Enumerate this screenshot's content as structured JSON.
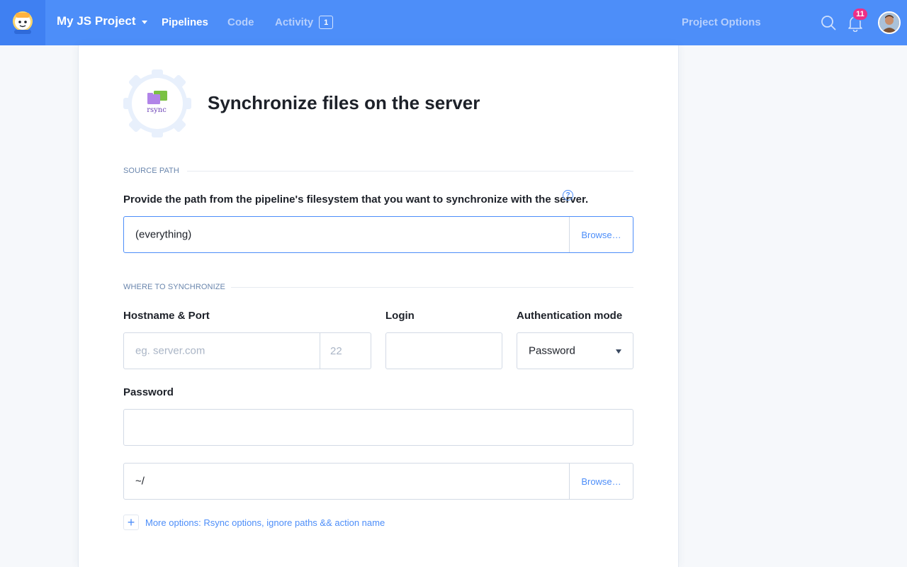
{
  "header": {
    "project_name": "My JS Project",
    "nav": {
      "pipelines": "Pipelines",
      "code": "Code",
      "activity": "Activity",
      "activity_count": "1"
    },
    "project_options": "Project Options",
    "notifications_count": "11"
  },
  "action": {
    "icon_label": "rsync",
    "title": "Synchronize files on the server"
  },
  "source_section": {
    "label": "SOURCE PATH",
    "field_label": "Provide the path from the pipeline's filesystem that you want to synchronize with the server.",
    "help_glyph": "?",
    "value": "(everything)",
    "browse_label": "Browse…"
  },
  "target_section": {
    "label": "WHERE TO SYNCHRONIZE",
    "hostname_label": "Hostname & Port",
    "hostname_placeholder": "eg. server.com",
    "port_placeholder": "22",
    "login_label": "Login",
    "login_value": "",
    "auth_label": "Authentication mode",
    "auth_value": "Password",
    "password_label": "Password",
    "password_value": "",
    "remote_path_value": "~/",
    "remote_browse_label": "Browse…"
  },
  "more_options": {
    "plus": "+",
    "label": "More options: Rsync options, ignore paths && action name"
  },
  "colors": {
    "header_bg": "#4d8ef9",
    "accent": "#4d8ef9",
    "badge": "#ee2f86"
  }
}
